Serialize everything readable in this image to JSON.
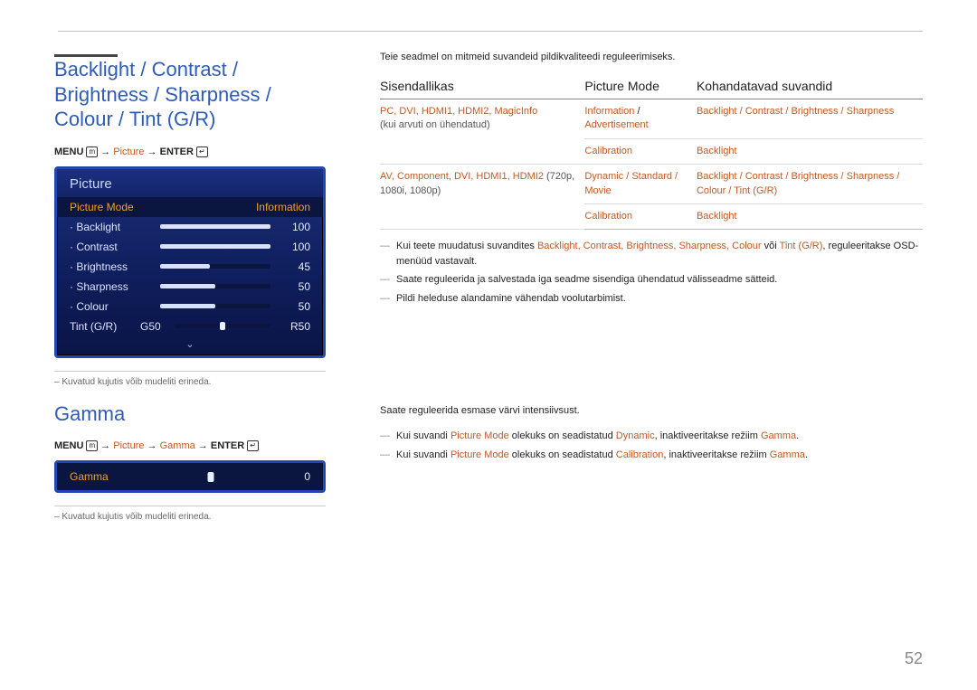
{
  "page_number": "52",
  "section1": {
    "title": "Backlight / Contrast / Brightness / Sharpness / Colour / Tint (G/R)",
    "path_prefix": "MENU",
    "path_highlight": "Picture",
    "path_suffix": "ENTER",
    "osd_title": "Picture",
    "osd_header_left": "Picture Mode",
    "osd_header_right": "Information",
    "items": [
      {
        "label": "Backlight",
        "value": "100",
        "pct": 100
      },
      {
        "label": "Contrast",
        "value": "100",
        "pct": 100
      },
      {
        "label": "Brightness",
        "value": "45",
        "pct": 45
      },
      {
        "label": "Sharpness",
        "value": "50",
        "pct": 50
      },
      {
        "label": "Colour",
        "value": "50",
        "pct": 50
      }
    ],
    "tint": {
      "label": "Tint (G/R)",
      "left": "G50",
      "right": "R50"
    },
    "footnote": "Kuvatud kujutis võib mudeliti erineda."
  },
  "section2": {
    "title": "Gamma",
    "path_prefix": "MENU",
    "path_hl1": "Picture",
    "path_hl2": "Gamma",
    "path_suffix": "ENTER",
    "osd_label": "Gamma",
    "osd_value": "0",
    "footnote": "Kuvatud kujutis võib mudeliti erineda."
  },
  "right": {
    "intro": "Teie seadmel on mitmeid suvandeid pildikvaliteedi reguleerimiseks.",
    "headers": {
      "c1": "Sisendallikas",
      "c2": "Picture Mode",
      "c3": "Kohandatavad suvandid"
    },
    "rows": [
      {
        "c1_hl": "PC, DVI, HDMI1, HDMI2, MagicInfo",
        "c1_sub": "(kui arvuti on ühendatud)",
        "c2_a": "Information",
        "c2_sep": " / ",
        "c2_b": "Advertisement",
        "c3": "Backlight / Contrast / Brightness / Sharpness"
      },
      {
        "c1": "",
        "c2": "Calibration",
        "c3": "Backlight"
      },
      {
        "c1_hl": "AV, Component, DVI, HDMI1, HDMI2",
        "c1_sub": " (720p, 1080i, 1080p)",
        "c2": "Dynamic / Standard / Movie",
        "c3": "Backlight / Contrast / Brightness / Sharpness / Colour / Tint (G/R)"
      },
      {
        "c1": "",
        "c2": "Calibration",
        "c3": "Backlight"
      }
    ],
    "notes": [
      {
        "pre": "Kui teete muudatusi suvandites ",
        "hl": "Backlight, Contrast, Brightness, Sharpness, Colour",
        "mid": " või ",
        "hl2": "Tint (G/R)",
        "post": ", reguleeritakse OSD-menüüd vastavalt."
      },
      {
        "text": "Saate reguleerida ja salvestada iga seadme sisendiga ühendatud välisseadme sätteid."
      },
      {
        "text": "Pildi heleduse alandamine vähendab voolutarbimist."
      }
    ],
    "gamma_intro": "Saate reguleerida esmase värvi intensiivsust.",
    "gamma_notes": [
      {
        "pre": "Kui suvandi ",
        "hl1": "Picture Mode",
        "mid1": " olekuks on seadistatud ",
        "hl2": "Dynamic",
        "mid2": ", inaktiveeritakse režiim ",
        "hl3": "Gamma",
        "post": "."
      },
      {
        "pre": "Kui suvandi ",
        "hl1": "Picture Mode",
        "mid1": " olekuks on seadistatud ",
        "hl2": "Calibration",
        "mid2": ", inaktiveeritakse režiim ",
        "hl3": "Gamma",
        "post": "."
      }
    ]
  }
}
